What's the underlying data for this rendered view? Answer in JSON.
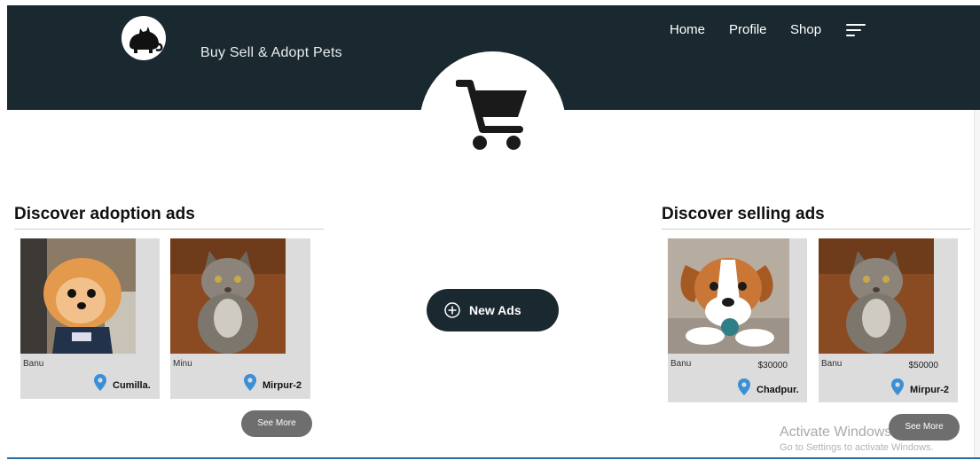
{
  "header": {
    "brand": "Buy Sell & Adopt Pets",
    "nav": [
      "Home",
      "Profile",
      "Shop"
    ],
    "logo_icon": "cat-icon",
    "menu_icon": "menu-icon",
    "background": "#1a2930"
  },
  "hero": {
    "icon": "cart-icon"
  },
  "adoption": {
    "title": "Discover adoption ads",
    "cards": [
      {
        "name": "Banu",
        "location": "Cumilla."
      },
      {
        "name": "Minu",
        "location": "Mirpur-2"
      }
    ],
    "see_more": "See More"
  },
  "selling": {
    "title": "Discover selling ads",
    "cards": [
      {
        "name": "Banu",
        "price": "$30000",
        "location": "Chadpur."
      },
      {
        "name": "Banu",
        "price": "$50000",
        "location": "Mirpur-2"
      }
    ],
    "see_more": "See More"
  },
  "new_ads": {
    "label": "New Ads",
    "icon": "plus-circle-icon"
  },
  "watermark": {
    "line1": "Activate Windows",
    "line2": "Go to Settings to activate Windows."
  },
  "colors": {
    "accent": "#1a2930",
    "pin": "#3b8fd6",
    "card": "#dcdcdc",
    "button": "#6e6e6e"
  }
}
